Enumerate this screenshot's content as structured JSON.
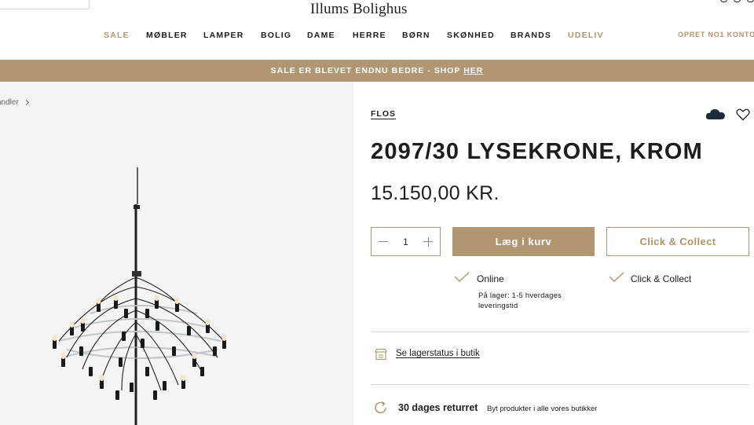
{
  "header": {
    "logo": "Illums Bolighus",
    "create_account": "OPRET NO1 KONTO"
  },
  "nav": [
    {
      "label": "SALE"
    },
    {
      "label": "MØBLER"
    },
    {
      "label": "LAMPER"
    },
    {
      "label": "BOLIG"
    },
    {
      "label": "DAME"
    },
    {
      "label": "HERRE"
    },
    {
      "label": "BØRN"
    },
    {
      "label": "SKØNHED"
    },
    {
      "label": "BRANDS"
    },
    {
      "label": "UDELIV"
    }
  ],
  "banner": {
    "text": "SALE ER BLEVET ENDNU BEDRE - SHOP ",
    "link": "HER"
  },
  "breadcrumb": "andler",
  "product": {
    "brand": "FLOS",
    "title": "2097/30 LYSEKRONE, KROM",
    "price": "15.150,00 KR.",
    "quantity": "1",
    "add_to_cart": "Læg i kurv",
    "click_collect": "Click & Collect"
  },
  "availability": {
    "online_label": "Online",
    "online_detail": "På lager: 1-5 hverdages leveringstid",
    "cc_label": "Click & Collect"
  },
  "store_status": "Se lagerstatus i butik",
  "returns": {
    "title": "30 dages returret",
    "subtitle": "Byt produkter i alle vores butikker"
  },
  "colors": {
    "accent": "#b19672",
    "text": "#1d1d1b"
  },
  "icons": [
    "cloud-icon",
    "heart-icon",
    "check-icon",
    "store-icon",
    "return-icon",
    "minus-icon",
    "plus-icon",
    "chevron-right-icon"
  ]
}
